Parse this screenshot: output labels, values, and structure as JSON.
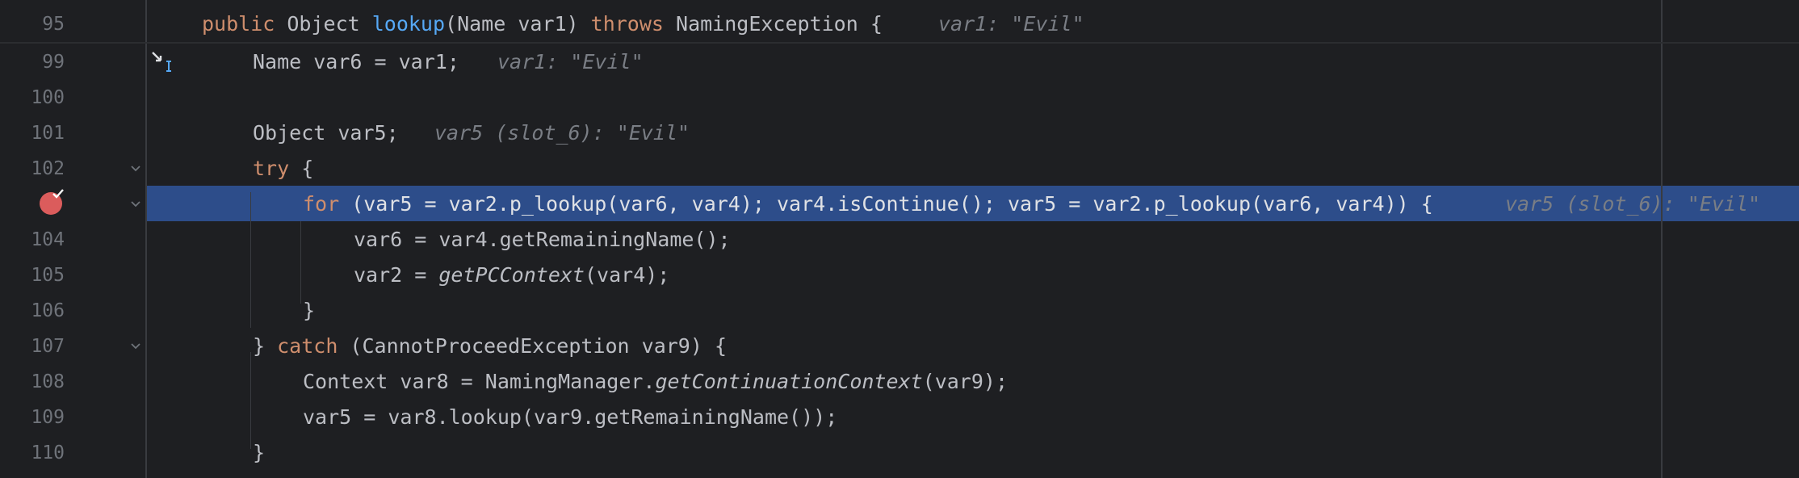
{
  "editor": {
    "sticky_line": {
      "number": "95",
      "tokens": [
        {
          "text": "public ",
          "style": "kw"
        },
        {
          "text": "Object ",
          "style": ""
        },
        {
          "text": "lookup",
          "style": "fn"
        },
        {
          "text": "(Name var1) ",
          "style": ""
        },
        {
          "text": "throws ",
          "style": "kw"
        },
        {
          "text": "NamingException {",
          "style": ""
        }
      ],
      "hint": "var1: \"Evil\""
    },
    "lines": [
      {
        "number": "99",
        "code_a": "Name var6 = var1;",
        "hint": "var1: \"Evil\""
      },
      {
        "number": "100",
        "code_a": "",
        "hint": ""
      },
      {
        "number": "101",
        "code_a": "Object var5;",
        "hint": "var5 (slot_6): \"Evil\""
      },
      {
        "number": "102",
        "kw": "try",
        "code_a": " {",
        "hint": ""
      },
      {
        "number": "",
        "kw": "for",
        "code_a": " (var5 = var2.p_lookup(var6, var4); var4.isContinue(); var5 = var2.p_lookup(var6, var4)) {",
        "hint": "var5 (slot_6): \"Evil\""
      },
      {
        "number": "104",
        "code_a": "var6 = var4.getRemainingName();",
        "hint": ""
      },
      {
        "number": "105",
        "code_a": "var2 = ",
        "italic": "getPCContext",
        "code_b": "(var4);",
        "hint": ""
      },
      {
        "number": "106",
        "code_a": "}",
        "hint": ""
      },
      {
        "number": "107",
        "code_a": "} ",
        "kw": "catch",
        "code_b": " (CannotProceedException var9) {",
        "hint": ""
      },
      {
        "number": "108",
        "code_a": "Context var8 = NamingManager.",
        "italic": "getContinuationContext",
        "code_b": "(var9);",
        "hint": ""
      },
      {
        "number": "109",
        "code_a": "var5 = var8.lookup(var9.getRemainingName());",
        "hint": ""
      },
      {
        "number": "110",
        "code_a": "}",
        "hint": ""
      }
    ],
    "icons": {
      "breakpoint": "breakpoint-icon",
      "fold": "chevron-down-icon",
      "cursor": "step-into-cursor-icon"
    },
    "colors": {
      "background": "#1e1f22",
      "execution_line": "#2d4d8a",
      "keyword": "#cf8e6d",
      "method": "#56a8f5",
      "breakpoint": "#db5c5c"
    }
  }
}
